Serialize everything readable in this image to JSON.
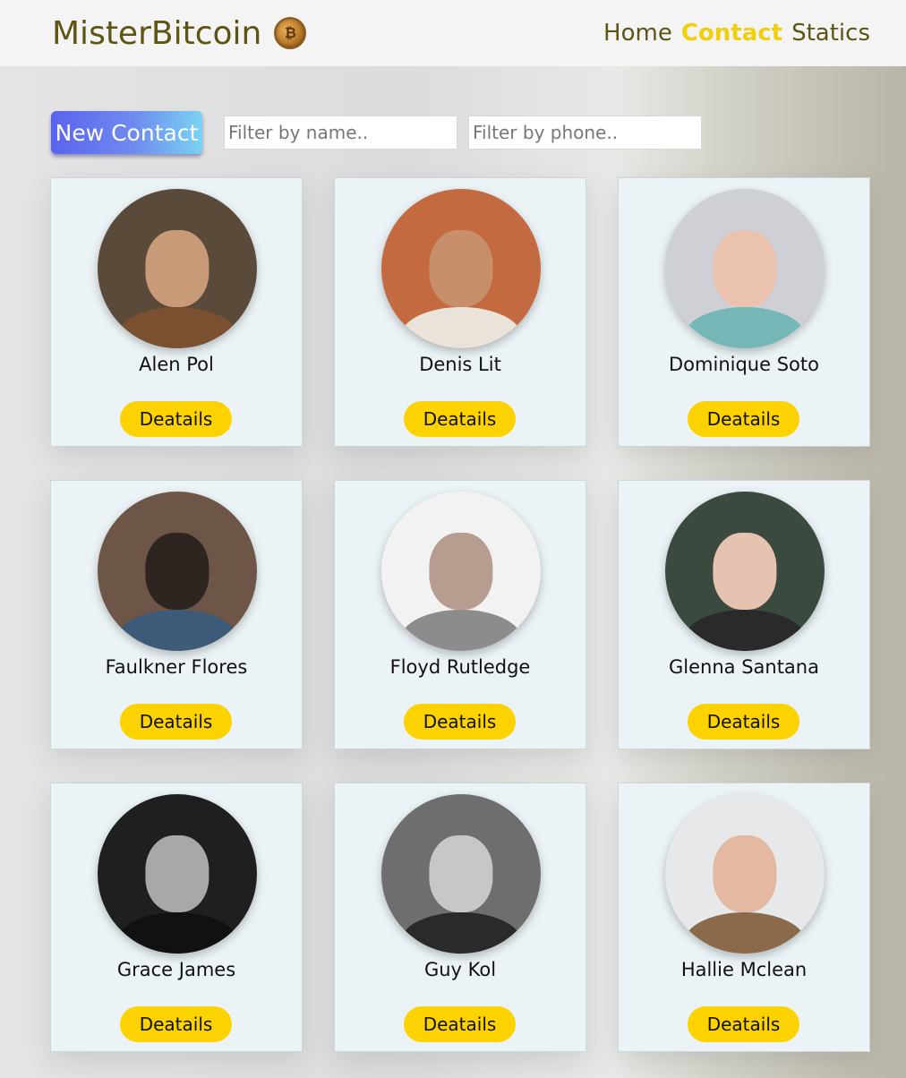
{
  "header": {
    "brand": "MisterBitcoin",
    "logo_icon": "bitcoin-coin-icon",
    "nav": [
      {
        "label": "Home",
        "active": false
      },
      {
        "label": "Contact",
        "active": true
      },
      {
        "label": "Statics",
        "active": false
      }
    ]
  },
  "toolbar": {
    "new_contact_label": "New Contact",
    "filter_name_placeholder": "Filter by name..",
    "filter_phone_placeholder": "Filter by phone.."
  },
  "contacts": [
    {
      "name": "Alen Pol",
      "details_label": "Deatails",
      "bg": "#5a4a3a",
      "skin": "#c99a78",
      "top": "#7a5030"
    },
    {
      "name": "Denis Lit",
      "details_label": "Deatails",
      "bg": "#c46a40",
      "skin": "#c8906a",
      "top": "#e9e3da"
    },
    {
      "name": "Dominique Soto",
      "details_label": "Deatails",
      "bg": "#cfcfd6",
      "skin": "#eac2ad",
      "top": "#74b7b6"
    },
    {
      "name": "Faulkner Flores",
      "details_label": "Deatails",
      "bg": "#6d5547",
      "skin": "#2d2520",
      "top": "#3d5a78"
    },
    {
      "name": "Floyd Rutledge",
      "details_label": "Deatails",
      "bg": "#f2f2f2",
      "skin": "#b79d90",
      "top": "#8c8c8c"
    },
    {
      "name": "Glenna Santana",
      "details_label": "Deatails",
      "bg": "#3b4a3e",
      "skin": "#e6c3b0",
      "top": "#2a2a2a"
    },
    {
      "name": "Grace James",
      "details_label": "Deatails",
      "bg": "#1f1f1f",
      "skin": "#a8a8a8",
      "top": "#111111"
    },
    {
      "name": "Guy Kol",
      "details_label": "Deatails",
      "bg": "#6e6e6e",
      "skin": "#c7c7c7",
      "top": "#2a2a2a"
    },
    {
      "name": "Hallie Mclean",
      "details_label": "Deatails",
      "bg": "#e6e8ea",
      "skin": "#e3b9a2",
      "top": "#8a6a4a"
    }
  ],
  "colors": {
    "accent_yellow": "#fcd200",
    "brand_olive": "#5e5414",
    "button_gradient_start": "#5b63ee",
    "button_gradient_end": "#7ad3f3",
    "card_bg": "#ebf3f6"
  }
}
